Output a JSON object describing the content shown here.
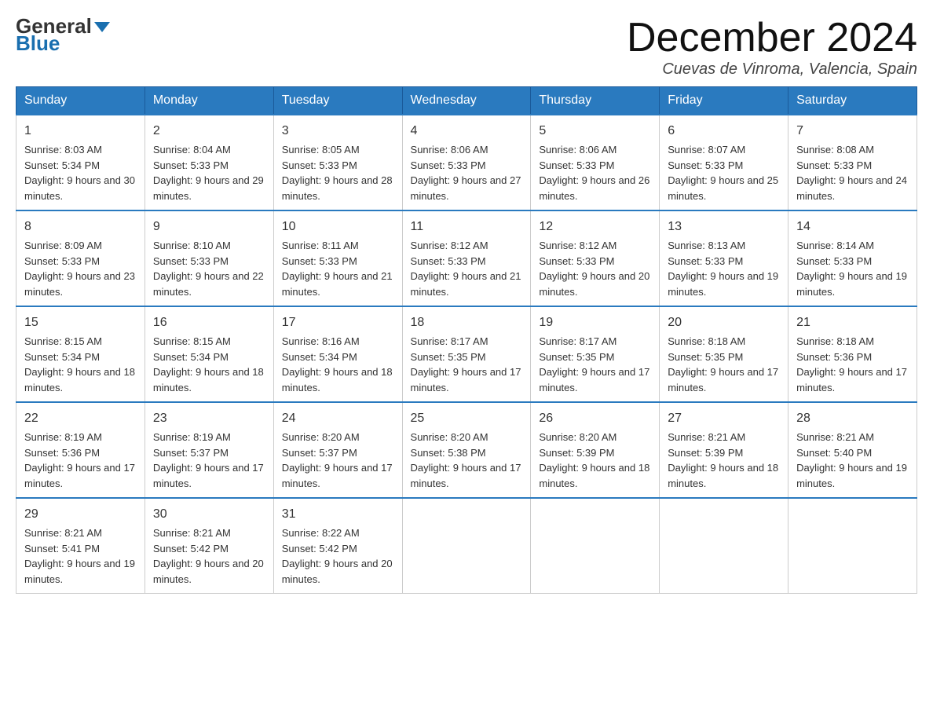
{
  "header": {
    "logo": {
      "line1": "General",
      "line2": "Blue"
    },
    "title": "December 2024",
    "location": "Cuevas de Vinroma, Valencia, Spain"
  },
  "calendar": {
    "days_of_week": [
      "Sunday",
      "Monday",
      "Tuesday",
      "Wednesday",
      "Thursday",
      "Friday",
      "Saturday"
    ],
    "weeks": [
      [
        {
          "day": "1",
          "sunrise": "8:03 AM",
          "sunset": "5:34 PM",
          "daylight": "9 hours and 30 minutes."
        },
        {
          "day": "2",
          "sunrise": "8:04 AM",
          "sunset": "5:33 PM",
          "daylight": "9 hours and 29 minutes."
        },
        {
          "day": "3",
          "sunrise": "8:05 AM",
          "sunset": "5:33 PM",
          "daylight": "9 hours and 28 minutes."
        },
        {
          "day": "4",
          "sunrise": "8:06 AM",
          "sunset": "5:33 PM",
          "daylight": "9 hours and 27 minutes."
        },
        {
          "day": "5",
          "sunrise": "8:06 AM",
          "sunset": "5:33 PM",
          "daylight": "9 hours and 26 minutes."
        },
        {
          "day": "6",
          "sunrise": "8:07 AM",
          "sunset": "5:33 PM",
          "daylight": "9 hours and 25 minutes."
        },
        {
          "day": "7",
          "sunrise": "8:08 AM",
          "sunset": "5:33 PM",
          "daylight": "9 hours and 24 minutes."
        }
      ],
      [
        {
          "day": "8",
          "sunrise": "8:09 AM",
          "sunset": "5:33 PM",
          "daylight": "9 hours and 23 minutes."
        },
        {
          "day": "9",
          "sunrise": "8:10 AM",
          "sunset": "5:33 PM",
          "daylight": "9 hours and 22 minutes."
        },
        {
          "day": "10",
          "sunrise": "8:11 AM",
          "sunset": "5:33 PM",
          "daylight": "9 hours and 21 minutes."
        },
        {
          "day": "11",
          "sunrise": "8:12 AM",
          "sunset": "5:33 PM",
          "daylight": "9 hours and 21 minutes."
        },
        {
          "day": "12",
          "sunrise": "8:12 AM",
          "sunset": "5:33 PM",
          "daylight": "9 hours and 20 minutes."
        },
        {
          "day": "13",
          "sunrise": "8:13 AM",
          "sunset": "5:33 PM",
          "daylight": "9 hours and 19 minutes."
        },
        {
          "day": "14",
          "sunrise": "8:14 AM",
          "sunset": "5:33 PM",
          "daylight": "9 hours and 19 minutes."
        }
      ],
      [
        {
          "day": "15",
          "sunrise": "8:15 AM",
          "sunset": "5:34 PM",
          "daylight": "9 hours and 18 minutes."
        },
        {
          "day": "16",
          "sunrise": "8:15 AM",
          "sunset": "5:34 PM",
          "daylight": "9 hours and 18 minutes."
        },
        {
          "day": "17",
          "sunrise": "8:16 AM",
          "sunset": "5:34 PM",
          "daylight": "9 hours and 18 minutes."
        },
        {
          "day": "18",
          "sunrise": "8:17 AM",
          "sunset": "5:35 PM",
          "daylight": "9 hours and 17 minutes."
        },
        {
          "day": "19",
          "sunrise": "8:17 AM",
          "sunset": "5:35 PM",
          "daylight": "9 hours and 17 minutes."
        },
        {
          "day": "20",
          "sunrise": "8:18 AM",
          "sunset": "5:35 PM",
          "daylight": "9 hours and 17 minutes."
        },
        {
          "day": "21",
          "sunrise": "8:18 AM",
          "sunset": "5:36 PM",
          "daylight": "9 hours and 17 minutes."
        }
      ],
      [
        {
          "day": "22",
          "sunrise": "8:19 AM",
          "sunset": "5:36 PM",
          "daylight": "9 hours and 17 minutes."
        },
        {
          "day": "23",
          "sunrise": "8:19 AM",
          "sunset": "5:37 PM",
          "daylight": "9 hours and 17 minutes."
        },
        {
          "day": "24",
          "sunrise": "8:20 AM",
          "sunset": "5:37 PM",
          "daylight": "9 hours and 17 minutes."
        },
        {
          "day": "25",
          "sunrise": "8:20 AM",
          "sunset": "5:38 PM",
          "daylight": "9 hours and 17 minutes."
        },
        {
          "day": "26",
          "sunrise": "8:20 AM",
          "sunset": "5:39 PM",
          "daylight": "9 hours and 18 minutes."
        },
        {
          "day": "27",
          "sunrise": "8:21 AM",
          "sunset": "5:39 PM",
          "daylight": "9 hours and 18 minutes."
        },
        {
          "day": "28",
          "sunrise": "8:21 AM",
          "sunset": "5:40 PM",
          "daylight": "9 hours and 19 minutes."
        }
      ],
      [
        {
          "day": "29",
          "sunrise": "8:21 AM",
          "sunset": "5:41 PM",
          "daylight": "9 hours and 19 minutes."
        },
        {
          "day": "30",
          "sunrise": "8:21 AM",
          "sunset": "5:42 PM",
          "daylight": "9 hours and 20 minutes."
        },
        {
          "day": "31",
          "sunrise": "8:22 AM",
          "sunset": "5:42 PM",
          "daylight": "9 hours and 20 minutes."
        },
        null,
        null,
        null,
        null
      ]
    ]
  }
}
